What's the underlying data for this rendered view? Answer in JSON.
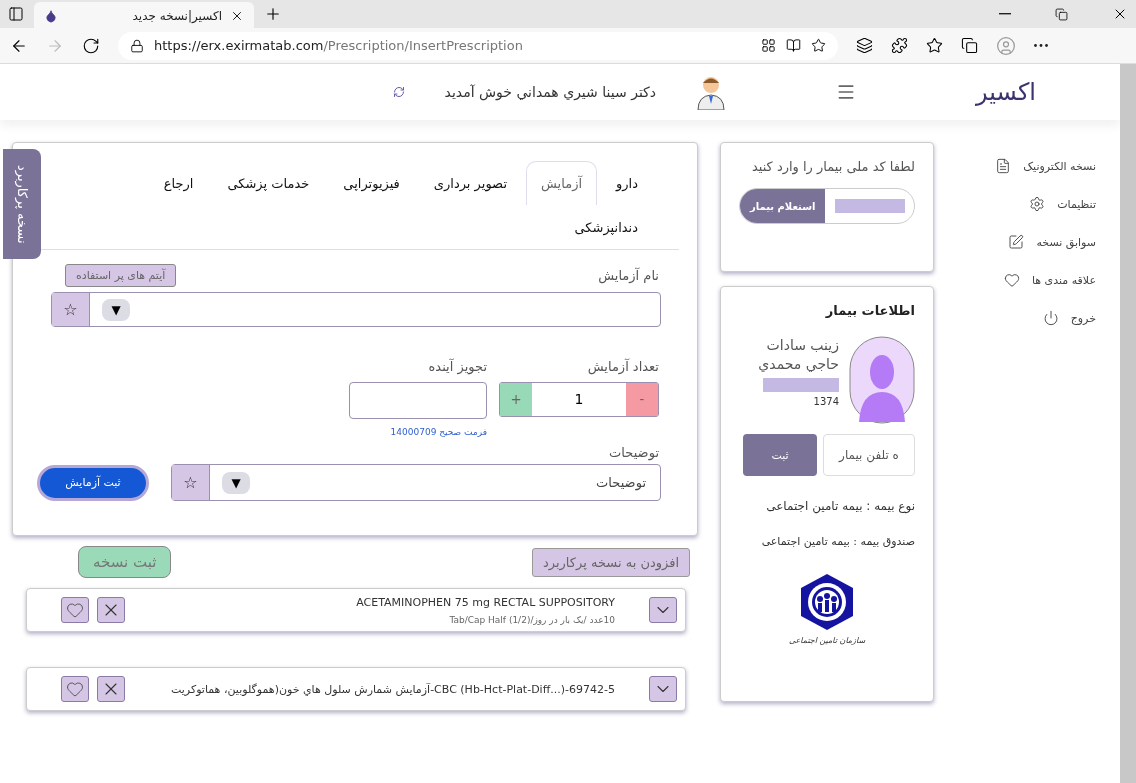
{
  "browser": {
    "tab_title": "اکسیر|نسخه جدید",
    "url_base": "https://erx.exirmatab.com",
    "url_path": "/Prescription/InsertPrescription"
  },
  "header": {
    "brand": "اکسیر",
    "welcome": "دکتر سینا شيري همداني خوش آمدید"
  },
  "side_tab": "نسخه پرکاربرد",
  "tabs": [
    {
      "label": "دارو",
      "selected": false
    },
    {
      "label": "آزمایش",
      "selected": true
    },
    {
      "label": "تصویر برداری",
      "selected": false
    },
    {
      "label": "فیزیوتراپی",
      "selected": false
    },
    {
      "label": "خدمات پزشکی",
      "selected": false
    },
    {
      "label": "ارجاع",
      "selected": false
    },
    {
      "label": "دندانپزشکی",
      "selected": false
    }
  ],
  "test_name": {
    "label": "نام آزمایش",
    "frequent_button": "آیتم های پر استفاده",
    "star": "☆",
    "caret": "▼"
  },
  "count": {
    "label": "تعداد آزمایش",
    "value": "1",
    "plus": "+",
    "minus": "-"
  },
  "future": {
    "label": "تجویز آینده",
    "hint": "فرمت صحیح 14000709"
  },
  "notes": {
    "label": "توضیحات",
    "placeholder": "توضیحات",
    "star": "☆",
    "caret": "▼"
  },
  "submit_test": "ثبت آزمایش",
  "add_frequent": "افزودن به نسخه پرکاربرد",
  "submit_prescription": "ثبت نسخه",
  "items": [
    {
      "title": "ACETAMINOPHEN  75 mg RECTAL SUPPOSITORY",
      "detail": "10عدد /یک بار در روز/(1/2) Tab/Cap Half"
    },
    {
      "title": "69742-5-(...CBC (Hb-Hct-Plat-Diff-آزمایش شمارش سلول هاي خون(هموگلوبين، هماتوکريت"
    }
  ],
  "national_id": {
    "title": "لطفا کد ملی بیمار را وارد کنید",
    "button": "استعلام بیمار"
  },
  "patient": {
    "heading": "اطلاعات بیمار",
    "name": "زینب سادات حاجي محمدي",
    "year": "1374",
    "phone_placeholder": "ه تلفن بیمار",
    "save": "ثبت",
    "insurance_type": "نوع بیمه : بیمه تامین اجتماعی",
    "insurance_fund": "صندوق بیمه : بیمه تامین اجتماعی",
    "logo_caption": "سازمان تامین اجتماعی"
  },
  "nav": [
    {
      "label": "نسخه الکترونیک",
      "kind": "document"
    },
    {
      "label": "تنظیمات",
      "kind": "settings"
    },
    {
      "label": "سوابق نسخه",
      "kind": "edit"
    },
    {
      "label": "علاقه مندی ها",
      "kind": "heart"
    },
    {
      "label": "خروج",
      "kind": "power"
    }
  ]
}
